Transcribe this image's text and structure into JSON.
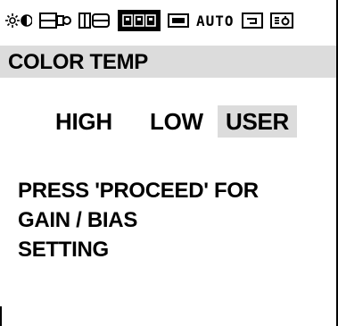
{
  "icons": [
    {
      "name": "brightness-contrast-icon"
    },
    {
      "name": "h-position-icon"
    },
    {
      "name": "v-position-icon"
    },
    {
      "name": "rgb-icon",
      "label": "RGB",
      "active": true
    },
    {
      "name": "size-icon"
    },
    {
      "name": "auto-icon",
      "label": "AUTO"
    },
    {
      "name": "recall-icon"
    },
    {
      "name": "exit-icon"
    }
  ],
  "menu": {
    "title": "COLOR TEMP",
    "options": [
      "HIGH",
      "LOW",
      "USER"
    ],
    "selected": "USER"
  },
  "message": {
    "line1": "PRESS 'PROCEED' FOR",
    "line2": "GAIN / BIAS",
    "line3": "SETTING"
  },
  "colors": {
    "highlight": "#dcdcdc",
    "text": "#000000",
    "background": "#ffffff"
  }
}
